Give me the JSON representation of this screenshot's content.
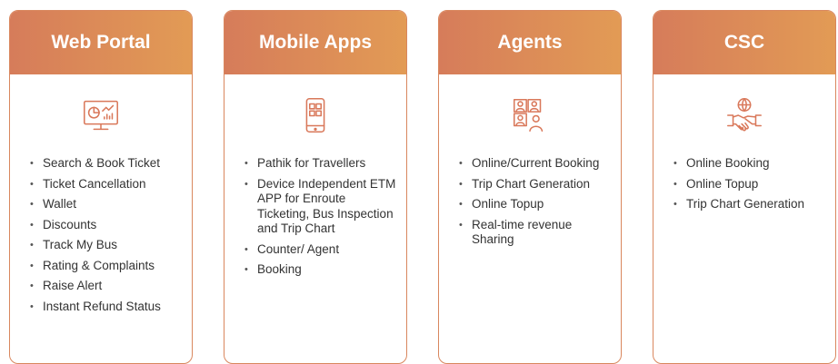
{
  "colors": {
    "accent_start": "#d67c5a",
    "accent_end": "#e29b55",
    "border": "#d9875e"
  },
  "cards": [
    {
      "title": "Web Portal",
      "icon": "monitor-dashboard-icon",
      "items": [
        "Search & Book Ticket",
        "Ticket Cancellation",
        "Wallet",
        "Discounts",
        "Track My Bus",
        "Rating & Complaints",
        "Raise Alert",
        "Instant Refund Status"
      ]
    },
    {
      "title": "Mobile Apps",
      "icon": "mobile-app-icon",
      "items": [
        "Pathik for Travellers",
        "Device Independent ETM APP for Enroute Ticketing, Bus Inspection and Trip Chart",
        "Counter/ Agent",
        "Booking"
      ]
    },
    {
      "title": "Agents",
      "icon": "agents-icon",
      "items": [
        "Online/Current Booking",
        "Trip Chart Generation",
        "Online Topup",
        "Real-time revenue Sharing"
      ]
    },
    {
      "title": "CSC",
      "icon": "handshake-globe-icon",
      "items": [
        "Online Booking",
        "Online Topup",
        "Trip Chart Generation"
      ]
    }
  ]
}
